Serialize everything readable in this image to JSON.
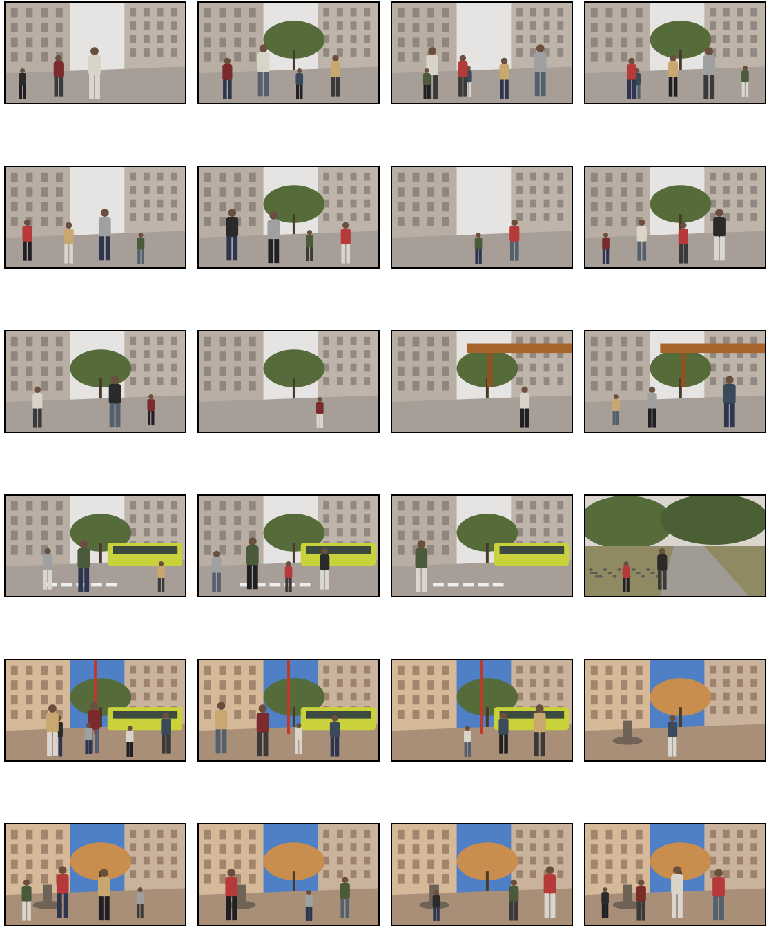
{
  "grid": {
    "rows": 6,
    "columns": 4
  },
  "frames": [
    {
      "scene": "gray-street",
      "people": 3
    },
    {
      "scene": "gray-street",
      "people": 4
    },
    {
      "scene": "gray-street",
      "people": 6
    },
    {
      "scene": "gray-street",
      "people": 5
    },
    {
      "scene": "gray-street",
      "people": 4
    },
    {
      "scene": "gray-street",
      "people": 4
    },
    {
      "scene": "gray-street",
      "people": 2
    },
    {
      "scene": "gray-street",
      "people": 4
    },
    {
      "scene": "gray-boulevard",
      "people": 3
    },
    {
      "scene": "gray-boulevard",
      "people": 1
    },
    {
      "scene": "gray-bridge",
      "people": 1
    },
    {
      "scene": "gray-bridge",
      "people": 3
    },
    {
      "scene": "gray-tram",
      "people": 3
    },
    {
      "scene": "gray-tram",
      "people": 4
    },
    {
      "scene": "gray-tram",
      "people": 1
    },
    {
      "scene": "gray-park",
      "people": 2
    },
    {
      "scene": "sunny-square-tram",
      "people": 6
    },
    {
      "scene": "sunny-square-tram",
      "people": 4
    },
    {
      "scene": "sunny-square-tram",
      "people": 3
    },
    {
      "scene": "sunny-fountain",
      "people": 1
    },
    {
      "scene": "sunny-fountain",
      "people": 4
    },
    {
      "scene": "sunny-fountain",
      "people": 3
    },
    {
      "scene": "sunny-fountain",
      "people": 3
    },
    {
      "scene": "sunny-fountain",
      "people": 4
    }
  ],
  "palette": {
    "frame_border": "#000000",
    "gray_sky": "#e6e4e2",
    "gray_building": "#b9aea3",
    "gray_ground": "#a89e98",
    "trees": "#556b3a",
    "tram_yellow": "#c9d23a",
    "sunny_sky": "#4f7fc4",
    "sunny_building": "#d6b999",
    "sunny_ground": "#a98f78",
    "autumn_trees": "#c98d4d"
  }
}
